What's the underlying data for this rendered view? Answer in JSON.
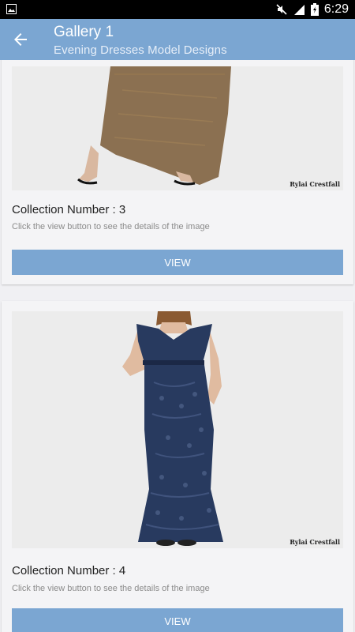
{
  "status_bar": {
    "time": "6:29",
    "icons": [
      "image-icon",
      "mute-icon",
      "signal-icon",
      "battery-charging-icon"
    ]
  },
  "app_bar": {
    "title": "Gallery 1",
    "subtitle": "Evening Dresses Model Designs",
    "back_icon": "arrow-back-icon"
  },
  "cards": [
    {
      "collection": "Collection Number : 3",
      "hint": "Click the view button to see the details of the image",
      "watermark": "Rylai Crestfall",
      "button": "VIEW"
    },
    {
      "collection": "Collection Number : 4",
      "hint": "Click the view button to see the details of the image",
      "watermark": "Rylai Crestfall",
      "button": "VIEW"
    }
  ],
  "colors": {
    "accent": "#7ba6d2",
    "background": "#f0f0f3",
    "dress_gold": "#7a5a36",
    "dress_navy": "#283a5f"
  }
}
